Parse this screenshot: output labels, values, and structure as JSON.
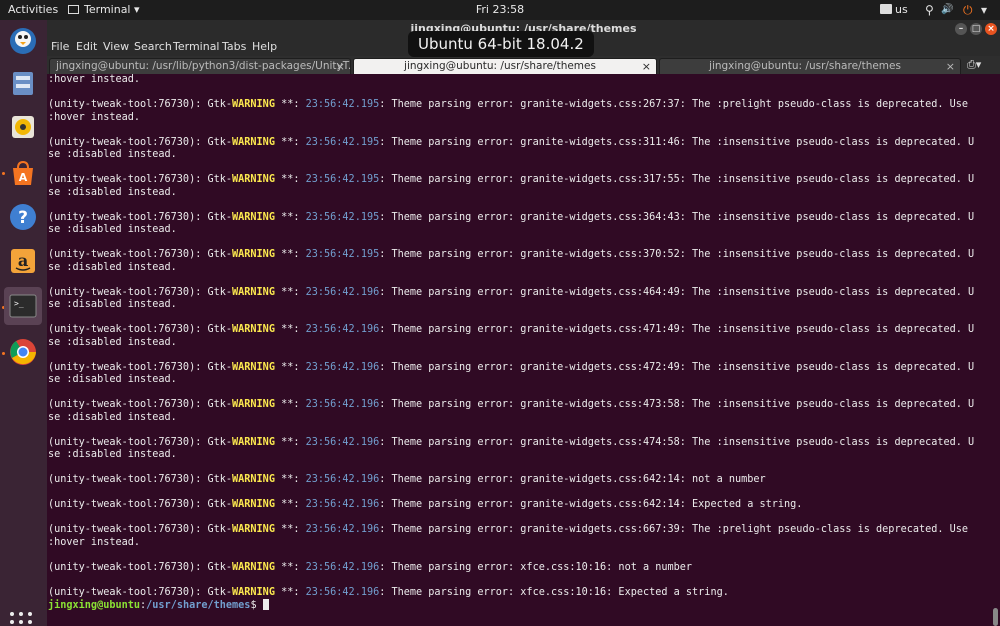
{
  "top_panel": {
    "activities": "Activities",
    "app_name": "Terminal",
    "app_arrow": "▾",
    "clock": "Fri 23:58",
    "keyboard_layout": "us",
    "network_icon": "⚲",
    "volume_icon": "🔊",
    "power_icon": "⏻",
    "menu_arrow": "▾"
  },
  "window": {
    "title": "jingxing@ubuntu: /usr/share/themes",
    "vm_overlay": "Ubuntu 64-bit 18.04.2",
    "menu": [
      "File",
      "Edit",
      "View",
      "Search",
      "Terminal",
      "Tabs",
      "Help"
    ],
    "tabs": [
      {
        "label": "jingxing@ubuntu: /usr/lib/python3/dist-packages/UnityT...",
        "close": "×"
      },
      {
        "label": "jingxing@ubuntu: /usr/share/themes",
        "close": "×"
      },
      {
        "label": "jingxing@ubuntu: /usr/share/themes",
        "close": "×"
      }
    ],
    "new_tab_icon": "⎙▾"
  },
  "dock": {
    "apps": [
      "thunderbird-icon",
      "files-icon",
      "rhythmbox-icon",
      "software-center-icon",
      "help-icon",
      "amazon-icon",
      "terminal-icon",
      "chrome-icon"
    ]
  },
  "terminal": {
    "lines": [
      {
        "kind": "plain",
        "text": ":hover instead."
      },
      {
        "kind": "blank"
      },
      {
        "kind": "warn",
        "prefix": "(unity-tweak-tool:76730): Gtk-",
        "level": "WARNING",
        "mid": " **: ",
        "time": "23:56:42.195",
        "msg": ": Theme parsing error: granite-widgets.css:267:37: The :prelight pseudo-class is deprecated. Use"
      },
      {
        "kind": "plain",
        "text": ":hover instead."
      },
      {
        "kind": "blank"
      },
      {
        "kind": "warn",
        "prefix": "(unity-tweak-tool:76730): Gtk-",
        "level": "WARNING",
        "mid": " **: ",
        "time": "23:56:42.195",
        "msg": ": Theme parsing error: granite-widgets.css:311:46: The :insensitive pseudo-class is deprecated. U"
      },
      {
        "kind": "plain",
        "text": "se :disabled instead."
      },
      {
        "kind": "blank"
      },
      {
        "kind": "warn",
        "prefix": "(unity-tweak-tool:76730): Gtk-",
        "level": "WARNING",
        "mid": " **: ",
        "time": "23:56:42.195",
        "msg": ": Theme parsing error: granite-widgets.css:317:55: The :insensitive pseudo-class is deprecated. U"
      },
      {
        "kind": "plain",
        "text": "se :disabled instead."
      },
      {
        "kind": "blank"
      },
      {
        "kind": "warn",
        "prefix": "(unity-tweak-tool:76730): Gtk-",
        "level": "WARNING",
        "mid": " **: ",
        "time": "23:56:42.195",
        "msg": ": Theme parsing error: granite-widgets.css:364:43: The :insensitive pseudo-class is deprecated. U"
      },
      {
        "kind": "plain",
        "text": "se :disabled instead."
      },
      {
        "kind": "blank"
      },
      {
        "kind": "warn",
        "prefix": "(unity-tweak-tool:76730): Gtk-",
        "level": "WARNING",
        "mid": " **: ",
        "time": "23:56:42.195",
        "msg": ": Theme parsing error: granite-widgets.css:370:52: The :insensitive pseudo-class is deprecated. U"
      },
      {
        "kind": "plain",
        "text": "se :disabled instead."
      },
      {
        "kind": "blank"
      },
      {
        "kind": "warn",
        "prefix": "(unity-tweak-tool:76730): Gtk-",
        "level": "WARNING",
        "mid": " **: ",
        "time": "23:56:42.196",
        "msg": ": Theme parsing error: granite-widgets.css:464:49: The :insensitive pseudo-class is deprecated. U"
      },
      {
        "kind": "plain",
        "text": "se :disabled instead."
      },
      {
        "kind": "blank"
      },
      {
        "kind": "warn",
        "prefix": "(unity-tweak-tool:76730): Gtk-",
        "level": "WARNING",
        "mid": " **: ",
        "time": "23:56:42.196",
        "msg": ": Theme parsing error: granite-widgets.css:471:49: The :insensitive pseudo-class is deprecated. U"
      },
      {
        "kind": "plain",
        "text": "se :disabled instead."
      },
      {
        "kind": "blank"
      },
      {
        "kind": "warn",
        "prefix": "(unity-tweak-tool:76730): Gtk-",
        "level": "WARNING",
        "mid": " **: ",
        "time": "23:56:42.196",
        "msg": ": Theme parsing error: granite-widgets.css:472:49: The :insensitive pseudo-class is deprecated. U"
      },
      {
        "kind": "plain",
        "text": "se :disabled instead."
      },
      {
        "kind": "blank"
      },
      {
        "kind": "warn",
        "prefix": "(unity-tweak-tool:76730): Gtk-",
        "level": "WARNING",
        "mid": " **: ",
        "time": "23:56:42.196",
        "msg": ": Theme parsing error: granite-widgets.css:473:58: The :insensitive pseudo-class is deprecated. U"
      },
      {
        "kind": "plain",
        "text": "se :disabled instead."
      },
      {
        "kind": "blank"
      },
      {
        "kind": "warn",
        "prefix": "(unity-tweak-tool:76730): Gtk-",
        "level": "WARNING",
        "mid": " **: ",
        "time": "23:56:42.196",
        "msg": ": Theme parsing error: granite-widgets.css:474:58: The :insensitive pseudo-class is deprecated. U"
      },
      {
        "kind": "plain",
        "text": "se :disabled instead."
      },
      {
        "kind": "blank"
      },
      {
        "kind": "warn",
        "prefix": "(unity-tweak-tool:76730): Gtk-",
        "level": "WARNING",
        "mid": " **: ",
        "time": "23:56:42.196",
        "msg": ": Theme parsing error: granite-widgets.css:642:14: not a number"
      },
      {
        "kind": "blank"
      },
      {
        "kind": "warn",
        "prefix": "(unity-tweak-tool:76730): Gtk-",
        "level": "WARNING",
        "mid": " **: ",
        "time": "23:56:42.196",
        "msg": ": Theme parsing error: granite-widgets.css:642:14: Expected a string."
      },
      {
        "kind": "blank"
      },
      {
        "kind": "warn",
        "prefix": "(unity-tweak-tool:76730): Gtk-",
        "level": "WARNING",
        "mid": " **: ",
        "time": "23:56:42.196",
        "msg": ": Theme parsing error: granite-widgets.css:667:39: The :prelight pseudo-class is deprecated. Use"
      },
      {
        "kind": "plain",
        "text": ":hover instead."
      },
      {
        "kind": "blank"
      },
      {
        "kind": "warn",
        "prefix": "(unity-tweak-tool:76730): Gtk-",
        "level": "WARNING",
        "mid": " **: ",
        "time": "23:56:42.196",
        "msg": ": Theme parsing error: xfce.css:10:16: not a number"
      },
      {
        "kind": "blank"
      },
      {
        "kind": "warn",
        "prefix": "(unity-tweak-tool:76730): Gtk-",
        "level": "WARNING",
        "mid": " **: ",
        "time": "23:56:42.196",
        "msg": ": Theme parsing error: xfce.css:10:16: Expected a string."
      },
      {
        "kind": "prompt",
        "user": "jingxing@ubuntu",
        "sep": ":",
        "path": "/usr/share/themes",
        "symbol": "$ "
      }
    ]
  },
  "colors": {
    "terminal_bg": "#300a24",
    "warning": "#fce94f",
    "timestamp": "#729fcf",
    "prompt_user": "#8ae234",
    "accent": "#f47421"
  }
}
